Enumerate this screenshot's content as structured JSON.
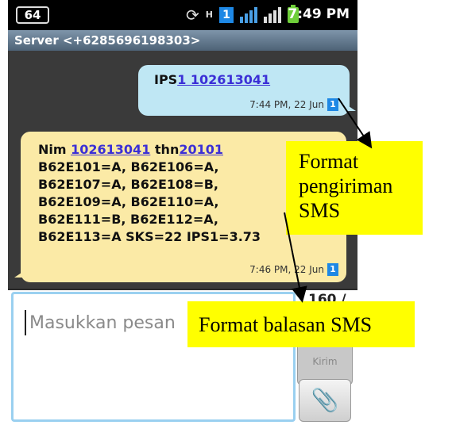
{
  "status_bar": {
    "notification_count": "64",
    "network_type": "H",
    "sim_badge": "1",
    "time": "7:49 PM"
  },
  "conversation": {
    "header": "Server <+6285696198303>"
  },
  "messages": {
    "sent": {
      "prefix": "IPS",
      "link_text": "1 102613041",
      "time": "7:44 PM, 22 Jun",
      "sim": "1"
    },
    "received": {
      "l1_a": "Nim ",
      "l1_link1": "102613041",
      "l1_b": " thn",
      "l1_link2": "20101",
      "l2": "B62E101=A, B62E106=A,",
      "l3": "B62E107=A, B62E108=B,",
      "l4": "B62E109=A, B62E110=A,",
      "l5": "B62E111=B, B62E112=A,",
      "l6": "B62E113=A SKS=22 IPS1=3.73",
      "time": "7:46 PM, 22 Jun",
      "sim": "1"
    }
  },
  "composer": {
    "placeholder": "Masukkan pesan",
    "char_counter": "160 /",
    "send_label": "Kirim"
  },
  "annotations": {
    "send_format": "Format pengiriman SMS",
    "reply_format": "Format balasan SMS"
  },
  "icons": {
    "sync": "sync-icon",
    "signal": "signal-icon",
    "battery": "battery-icon",
    "attach": "paperclip-icon"
  }
}
